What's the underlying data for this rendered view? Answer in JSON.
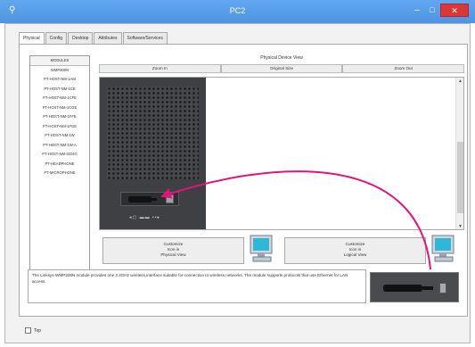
{
  "window": {
    "title": "PC2",
    "app_icon": "packet-tracer-icon",
    "buttons": {
      "minimize": "–",
      "maximize": "□",
      "close": "✕"
    }
  },
  "tabs": [
    {
      "label": "Physical",
      "active": true
    },
    {
      "label": "Config",
      "active": false
    },
    {
      "label": "Desktop",
      "active": false
    },
    {
      "label": "Attributes",
      "active": false
    },
    {
      "label": "Software/Services",
      "active": false
    }
  ],
  "modules": {
    "header": "MODULES",
    "items": [
      "WMP300N",
      "PT-HOST-NM-1AM",
      "PT-HOST-NM-1CE",
      "PT-HOST-NM-1CFE",
      "PT-HOST-NM-1CGE",
      "PT-HOST-NM-1FFE",
      "PT-HOST-NM-1FGE",
      "PT-HOST-NM-1W",
      "PT-HOST-NM-1W-A",
      "PT-HOST-NM-3G/4G",
      "PT-HEADPHONE",
      "PT-MICROPHONE"
    ]
  },
  "device_view": {
    "title": "Physical Device View",
    "zoom_in": "Zoom In",
    "original_size": "Original Size",
    "zoom_out": "Zoom Out"
  },
  "customize": {
    "physical": [
      "Customize",
      "Icon in",
      "Physical View"
    ],
    "logical": [
      "Customize",
      "Icon in",
      "Logical View"
    ]
  },
  "description": "The Linksys-WMP300N module provides one 2.4GHz wireless interface suitable for connection to wireless networks. The module supports protocols that use Ethernet for LAN access.",
  "top_checkbox": {
    "label": "Top",
    "checked": false
  },
  "colors": {
    "titlebar": "#5a9fea",
    "close": "#d9383a",
    "arrow": "#e0157a",
    "device": "#3f4043"
  }
}
